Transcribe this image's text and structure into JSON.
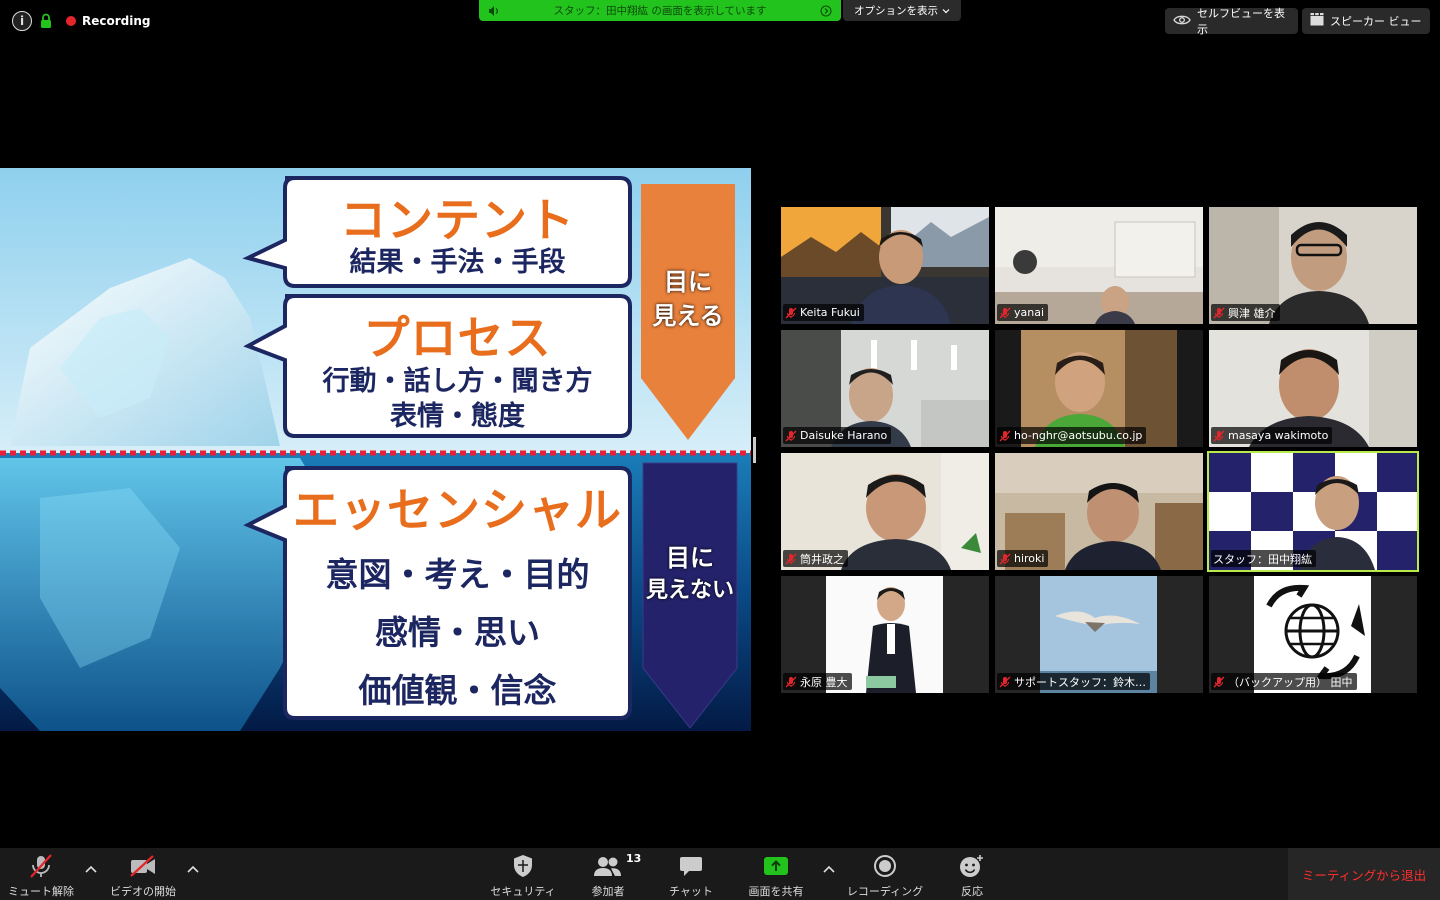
{
  "top": {
    "recording_label": "Recording",
    "share_banner": "スタッフ：田中翔紘 の画面を表示しています",
    "options_label": "オプションを表示",
    "selfview_label": "セルフビューを表示",
    "speakerview_label": "スピーカー ビュー"
  },
  "slide": {
    "box1_title": "コンテント",
    "box1_sub": "結果・手法・手段",
    "box2_title": "プロセス",
    "box2_line1": "行動・話し方・聞き方",
    "box2_line2": "表情・態度",
    "box3_title": "エッセンシャル",
    "box3_line1": "意図・考え・目的",
    "box3_line2": "感情・思い",
    "box3_line3": "価値観・信念",
    "visible_line1": "目に",
    "visible_line2": "見える",
    "invisible_line1": "目に",
    "invisible_line2": "見えない"
  },
  "participants": [
    {
      "name": "Keita Fukui"
    },
    {
      "name": "yanai"
    },
    {
      "name": "興津 雄介"
    },
    {
      "name": "Daisuke Harano"
    },
    {
      "name": "ho-nghr@aotsubu.co.jp"
    },
    {
      "name": "masaya wakimoto"
    },
    {
      "name": "筒井政之"
    },
    {
      "name": "hiroki"
    },
    {
      "name": "スタッフ：田中翔紘"
    },
    {
      "name": "永原 豊大"
    },
    {
      "name": "サポートスタッフ：鈴木…"
    },
    {
      "name": "（バックアップ用）  田中"
    }
  ],
  "toolbar": {
    "mute_label": "ミュート解除",
    "video_label": "ビデオの開始",
    "security_label": "セキュリティ",
    "participants_label": "参加者",
    "participants_count": "13",
    "chat_label": "チャット",
    "share_label": "画面を共有",
    "record_label": "レコーディング",
    "reactions_label": "反応",
    "leave_label": "ミーティングから退出"
  },
  "colors": {
    "banner_green": "#22c31d",
    "active_speaker": "#b9ea4b",
    "leave_red": "#ff2e2e",
    "slide_orange": "#e86d1c",
    "slide_navy": "#1c2660"
  }
}
